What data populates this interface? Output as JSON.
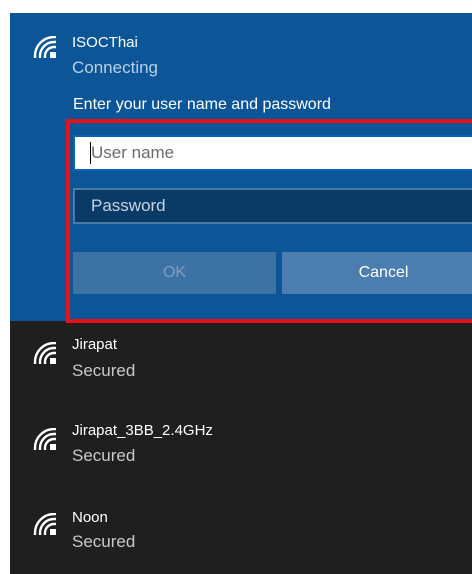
{
  "active_network": {
    "name": "ISOCThai",
    "status": "Connecting",
    "prompt": "Enter your user name and password",
    "username_placeholder": "User name",
    "password_placeholder": "Password",
    "ok_label": "OK",
    "cancel_label": "Cancel"
  },
  "networks": [
    {
      "name": "Jirapat",
      "status": "Secured"
    },
    {
      "name": "Jirapat_3BB_2.4GHz",
      "status": "Secured"
    },
    {
      "name": "Noon",
      "status": "Secured"
    }
  ],
  "icons": {
    "wifi": "wifi-signal-icon"
  },
  "colors": {
    "panel_background": "#0c5698",
    "list_background": "#1f1f1f",
    "highlight": "#e8101b"
  }
}
